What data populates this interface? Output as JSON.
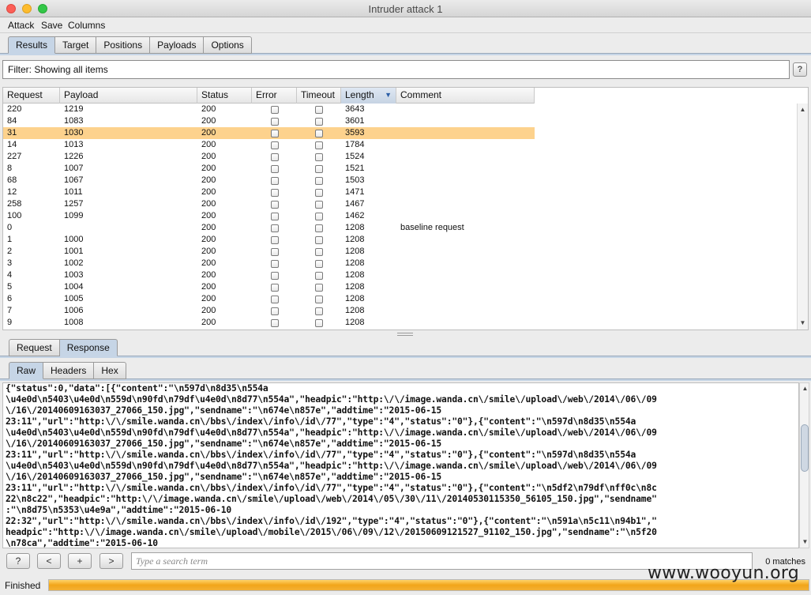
{
  "window": {
    "title": "Intruder attack 1"
  },
  "menu": [
    "Attack",
    "Save",
    "Columns"
  ],
  "tabs": [
    "Results",
    "Target",
    "Positions",
    "Payloads",
    "Options"
  ],
  "filter": {
    "text": "Filter: Showing all items",
    "help": "?"
  },
  "table": {
    "columns": [
      "Request",
      "Payload",
      "Status",
      "Error",
      "Timeout",
      "Length",
      "Comment"
    ],
    "sorted_column": "Length",
    "selected_row": 2,
    "rows": [
      {
        "request": "220",
        "payload": "1219",
        "status": "200",
        "length": "3643",
        "comment": ""
      },
      {
        "request": "84",
        "payload": "1083",
        "status": "200",
        "length": "3601",
        "comment": ""
      },
      {
        "request": "31",
        "payload": "1030",
        "status": "200",
        "length": "3593",
        "comment": ""
      },
      {
        "request": "14",
        "payload": "1013",
        "status": "200",
        "length": "1784",
        "comment": ""
      },
      {
        "request": "227",
        "payload": "1226",
        "status": "200",
        "length": "1524",
        "comment": ""
      },
      {
        "request": "8",
        "payload": "1007",
        "status": "200",
        "length": "1521",
        "comment": ""
      },
      {
        "request": "68",
        "payload": "1067",
        "status": "200",
        "length": "1503",
        "comment": ""
      },
      {
        "request": "12",
        "payload": "1011",
        "status": "200",
        "length": "1471",
        "comment": ""
      },
      {
        "request": "258",
        "payload": "1257",
        "status": "200",
        "length": "1467",
        "comment": ""
      },
      {
        "request": "100",
        "payload": "1099",
        "status": "200",
        "length": "1462",
        "comment": ""
      },
      {
        "request": "0",
        "payload": "",
        "status": "200",
        "length": "1208",
        "comment": "baseline request"
      },
      {
        "request": "1",
        "payload": "1000",
        "status": "200",
        "length": "1208",
        "comment": ""
      },
      {
        "request": "2",
        "payload": "1001",
        "status": "200",
        "length": "1208",
        "comment": ""
      },
      {
        "request": "3",
        "payload": "1002",
        "status": "200",
        "length": "1208",
        "comment": ""
      },
      {
        "request": "4",
        "payload": "1003",
        "status": "200",
        "length": "1208",
        "comment": ""
      },
      {
        "request": "5",
        "payload": "1004",
        "status": "200",
        "length": "1208",
        "comment": ""
      },
      {
        "request": "6",
        "payload": "1005",
        "status": "200",
        "length": "1208",
        "comment": ""
      },
      {
        "request": "7",
        "payload": "1006",
        "status": "200",
        "length": "1208",
        "comment": ""
      },
      {
        "request": "9",
        "payload": "1008",
        "status": "200",
        "length": "1208",
        "comment": ""
      }
    ]
  },
  "message_tabs": [
    "Request",
    "Response"
  ],
  "view_tabs": [
    "Raw",
    "Headers",
    "Hex"
  ],
  "response_lines": [
    "{\"status\":0,\"data\":[{\"content\":\"\\n597d\\n8d35\\n554a",
    "\\u4e0d\\n5403\\u4e0d\\n559d\\n90fd\\n79df\\u4e0d\\n8d77\\n554a\",\"headpic\":\"http:\\/\\/image.wanda.cn\\/smile\\/upload\\/web\\/2014\\/06\\/09",
    "\\/16\\/20140609163037_27066_150.jpg\",\"sendname\":\"\\n674e\\n857e\",\"addtime\":\"2015-06-15",
    "23:11\",\"url\":\"http:\\/\\/smile.wanda.cn\\/bbs\\/index\\/info\\/id\\/77\",\"type\":\"4\",\"status\":\"0\"},{\"content\":\"\\n597d\\n8d35\\n554a",
    "\\u4e0d\\n5403\\u4e0d\\n559d\\n90fd\\n79df\\u4e0d\\n8d77\\n554a\",\"headpic\":\"http:\\/\\/image.wanda.cn\\/smile\\/upload\\/web\\/2014\\/06\\/09",
    "\\/16\\/20140609163037_27066_150.jpg\",\"sendname\":\"\\n674e\\n857e\",\"addtime\":\"2015-06-15",
    "23:11\",\"url\":\"http:\\/\\/smile.wanda.cn\\/bbs\\/index\\/info\\/id\\/77\",\"type\":\"4\",\"status\":\"0\"},{\"content\":\"\\n597d\\n8d35\\n554a",
    "\\u4e0d\\n5403\\u4e0d\\n559d\\n90fd\\n79df\\u4e0d\\n8d77\\n554a\",\"headpic\":\"http:\\/\\/image.wanda.cn\\/smile\\/upload\\/web\\/2014\\/06\\/09",
    "\\/16\\/20140609163037_27066_150.jpg\",\"sendname\":\"\\n674e\\n857e\",\"addtime\":\"2015-06-15",
    "23:11\",\"url\":\"http:\\/\\/smile.wanda.cn\\/bbs\\/index\\/info\\/id\\/77\",\"type\":\"4\",\"status\":\"0\"},{\"content\":\"\\n5df2\\n79df\\nff0c\\n8c",
    "22\\n8c22\",\"headpic\":\"http:\\/\\/image.wanda.cn\\/smile\\/upload\\/web\\/2014\\/05\\/30\\/11\\/20140530115350_56105_150.jpg\",\"sendname\"",
    ":\"\\n8d75\\n5353\\u4e9a\",\"addtime\":\"2015-06-10",
    "22:32\",\"url\":\"http:\\/\\/smile.wanda.cn\\/bbs\\/index\\/info\\/id\\/192\",\"type\":\"4\",\"status\":\"0\"},{\"content\":\"\\n591a\\n5c11\\n94b1\",\"",
    "headpic\":\"http:\\/\\/image.wanda.cn\\/smile\\/upload\\/mobile\\/2015\\/06\\/09\\/12\\/20150609121527_91102_150.jpg\",\"sendname\":\"\\n5f20",
    "\\n78ca\",\"addtime\":\"2015-06-10"
  ],
  "search": {
    "help": "?",
    "prev": "<",
    "add": "+",
    "next": ">",
    "placeholder": "Type a search term",
    "matches": "0 matches"
  },
  "status": {
    "text": "Finished",
    "progress": 1.0
  },
  "watermark": "www.wooyun.org"
}
